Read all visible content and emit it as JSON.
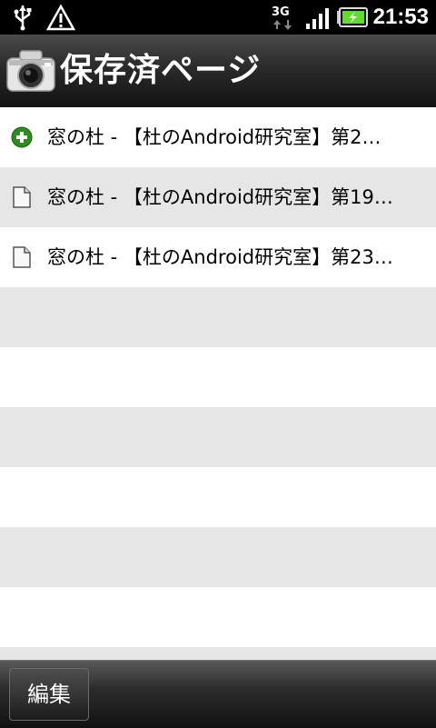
{
  "status_bar": {
    "time": "21:53",
    "network": "3G",
    "icons": [
      "usb-icon",
      "warning-icon",
      "3g-data-icon",
      "signal-icon",
      "battery-charging-icon"
    ]
  },
  "header": {
    "title": "保存済ページ",
    "icon": "camera-icon"
  },
  "list": {
    "items": [
      {
        "icon": "add-icon",
        "title": "窓の杜 - 【杜のAndroid研究室】第2…"
      },
      {
        "icon": "page-icon",
        "title": "窓の杜 - 【杜のAndroid研究室】第19…"
      },
      {
        "icon": "page-icon",
        "title": "窓の杜 - 【杜のAndroid研究室】第23…"
      }
    ]
  },
  "bottom_bar": {
    "edit_label": "編集"
  },
  "colors": {
    "row_alt": "#e6e6e6",
    "add_green": "#2e8b1e",
    "battery_green": "#5fdc2c"
  }
}
